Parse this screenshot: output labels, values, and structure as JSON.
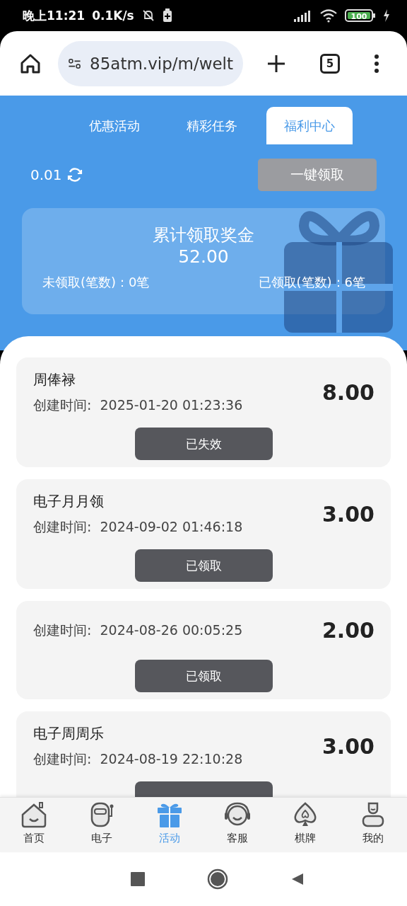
{
  "status_bar": {
    "time": "晚上11:21",
    "speed": "0.1K/s",
    "battery": "100",
    "charging": true
  },
  "browser": {
    "url": "85atm.vip/m/welt",
    "tab_count": "5"
  },
  "tabs": [
    {
      "label": "优惠活动",
      "selected": false
    },
    {
      "label": "精彩任务",
      "selected": false
    },
    {
      "label": "福利中心",
      "selected": true
    }
  ],
  "balance": "0.01",
  "claim_all_button": {
    "label": "一键领取",
    "disabled": true
  },
  "summary": {
    "title": "累计领取奖金",
    "total": "52.00",
    "unclaimed": "未领取(笔数)：0笔",
    "claimed": "已领取(笔数)：6笔"
  },
  "records": [
    {
      "title": "周俸禄",
      "created": "创建时间:  2025-01-20 01:23:36",
      "amount": "8.00",
      "status": "已失效"
    },
    {
      "title": "电子月月领",
      "created": "创建时间:  2024-09-02 01:46:18",
      "amount": "3.00",
      "status": "已领取"
    },
    {
      "created": "创建时间:  2024-08-26 00:05:25",
      "amount": "2.00",
      "status": "已领取"
    },
    {
      "title": "电子周周乐",
      "created": "创建时间:  2024-08-19 22:10:28",
      "amount": "3.00"
    }
  ],
  "bottom_nav": [
    {
      "label": "首页",
      "kind": "home",
      "selected": false
    },
    {
      "label": "电子",
      "kind": "robot",
      "selected": false
    },
    {
      "label": "活动",
      "kind": "gift",
      "selected": true
    },
    {
      "label": "客服",
      "kind": "headset",
      "selected": false
    },
    {
      "label": "棋牌",
      "kind": "spade",
      "selected": false
    },
    {
      "label": "我的",
      "kind": "user",
      "selected": false
    }
  ]
}
